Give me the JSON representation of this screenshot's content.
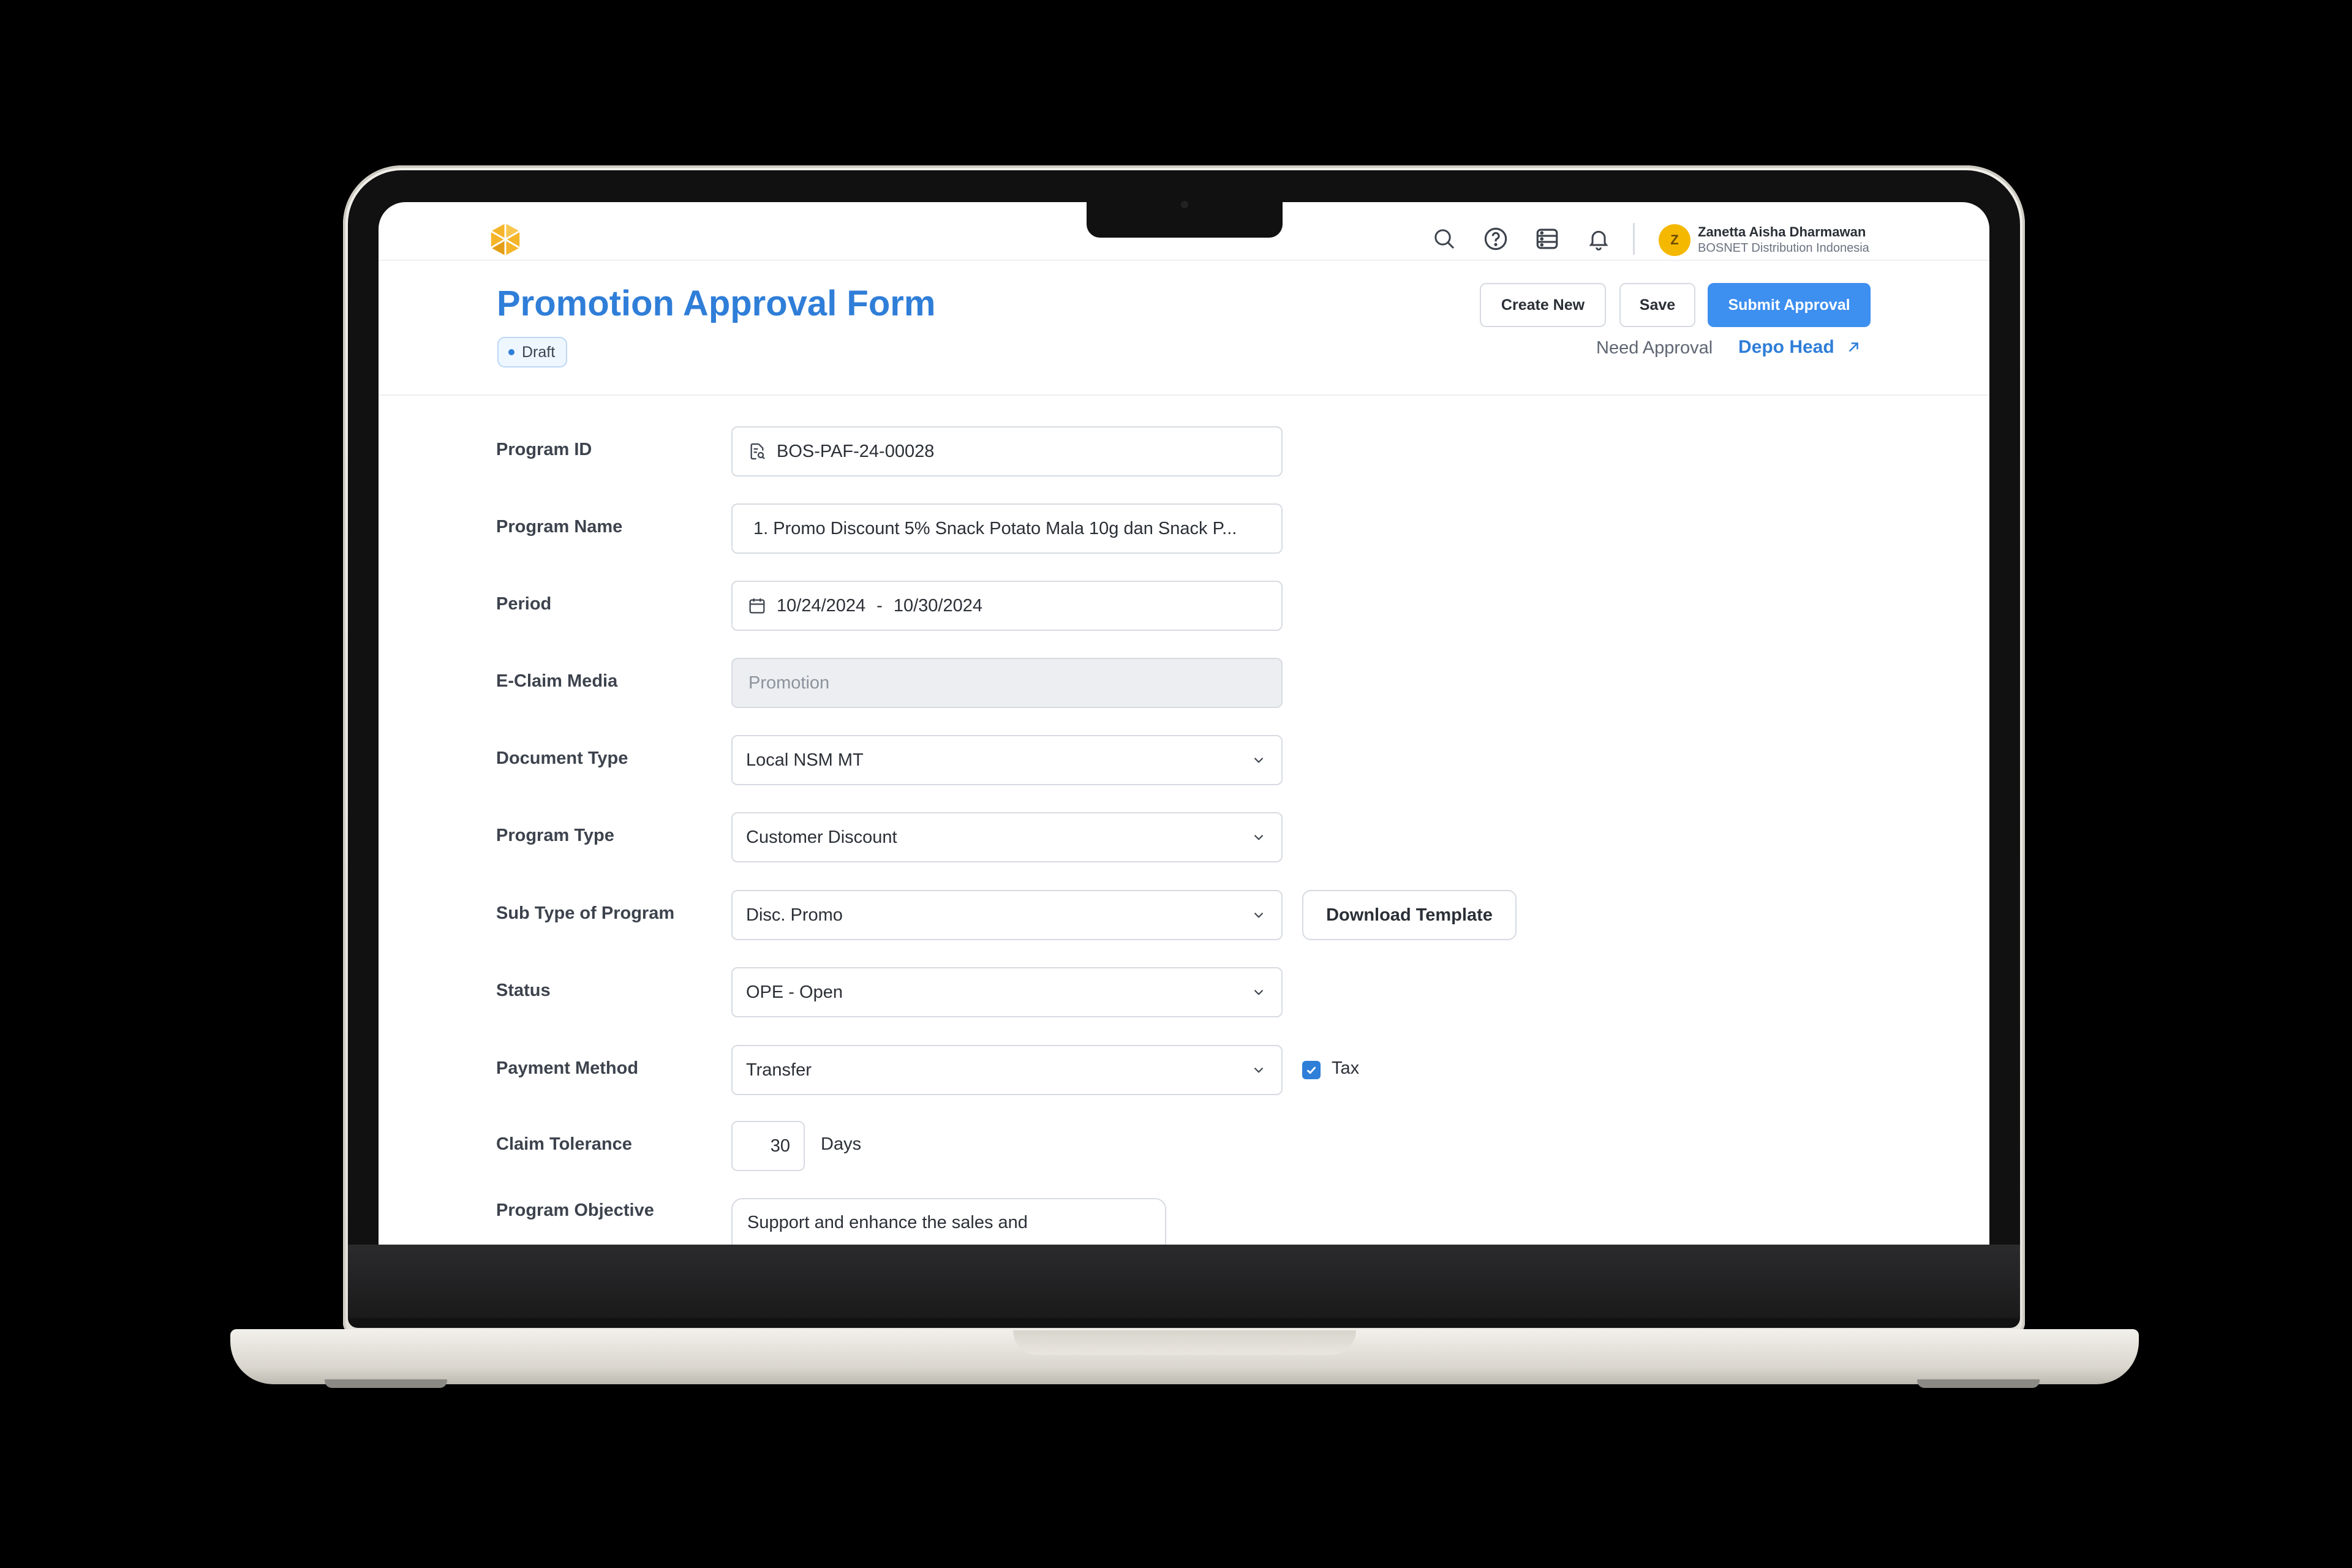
{
  "header": {
    "user_name": "Zanetta Aisha Dharmawan",
    "user_org": "BOSNET Distribution Indonesia",
    "avatar_initial": "Z",
    "icons": [
      "search-icon",
      "help-icon",
      "storage-icon",
      "bell-icon"
    ]
  },
  "page": {
    "title": "Promotion Approval Form",
    "status_badge": "Draft",
    "buttons": {
      "create_new": "Create New",
      "save": "Save",
      "submit": "Submit Approval"
    },
    "need_approval_label": "Need Approval",
    "approver": "Depo Head"
  },
  "form": {
    "program_id": {
      "label": "Program ID",
      "value": "BOS-PAF-24-00028"
    },
    "program_name": {
      "label": "Program Name",
      "value": "1. Promo Discount 5% Snack Potato Mala 10g dan Snack P..."
    },
    "period": {
      "label": "Period",
      "start": "10/24/2024",
      "separator": "-",
      "end": "10/30/2024"
    },
    "eclaim_media": {
      "label": "E-Claim Media",
      "placeholder": "Promotion"
    },
    "document_type": {
      "label": "Document Type",
      "value": "Local NSM MT"
    },
    "program_type": {
      "label": "Program Type",
      "value": "Customer Discount"
    },
    "sub_type": {
      "label": "Sub Type of Program",
      "value": "Disc. Promo",
      "download_label": "Download Template"
    },
    "status": {
      "label": "Status",
      "value": "OPE - Open"
    },
    "payment_method": {
      "label": "Payment Method",
      "value": "Transfer",
      "tax_label": "Tax",
      "tax_checked": true
    },
    "claim_tolerance": {
      "label": "Claim Tolerance",
      "value": "30",
      "unit": "Days"
    },
    "program_objective": {
      "label": "Program Objective",
      "value": "Support and enhance the sales and"
    }
  },
  "colors": {
    "accent": "#2f7ed8",
    "primary_button": "#3d8ff0",
    "logo": "#f5b52a"
  }
}
